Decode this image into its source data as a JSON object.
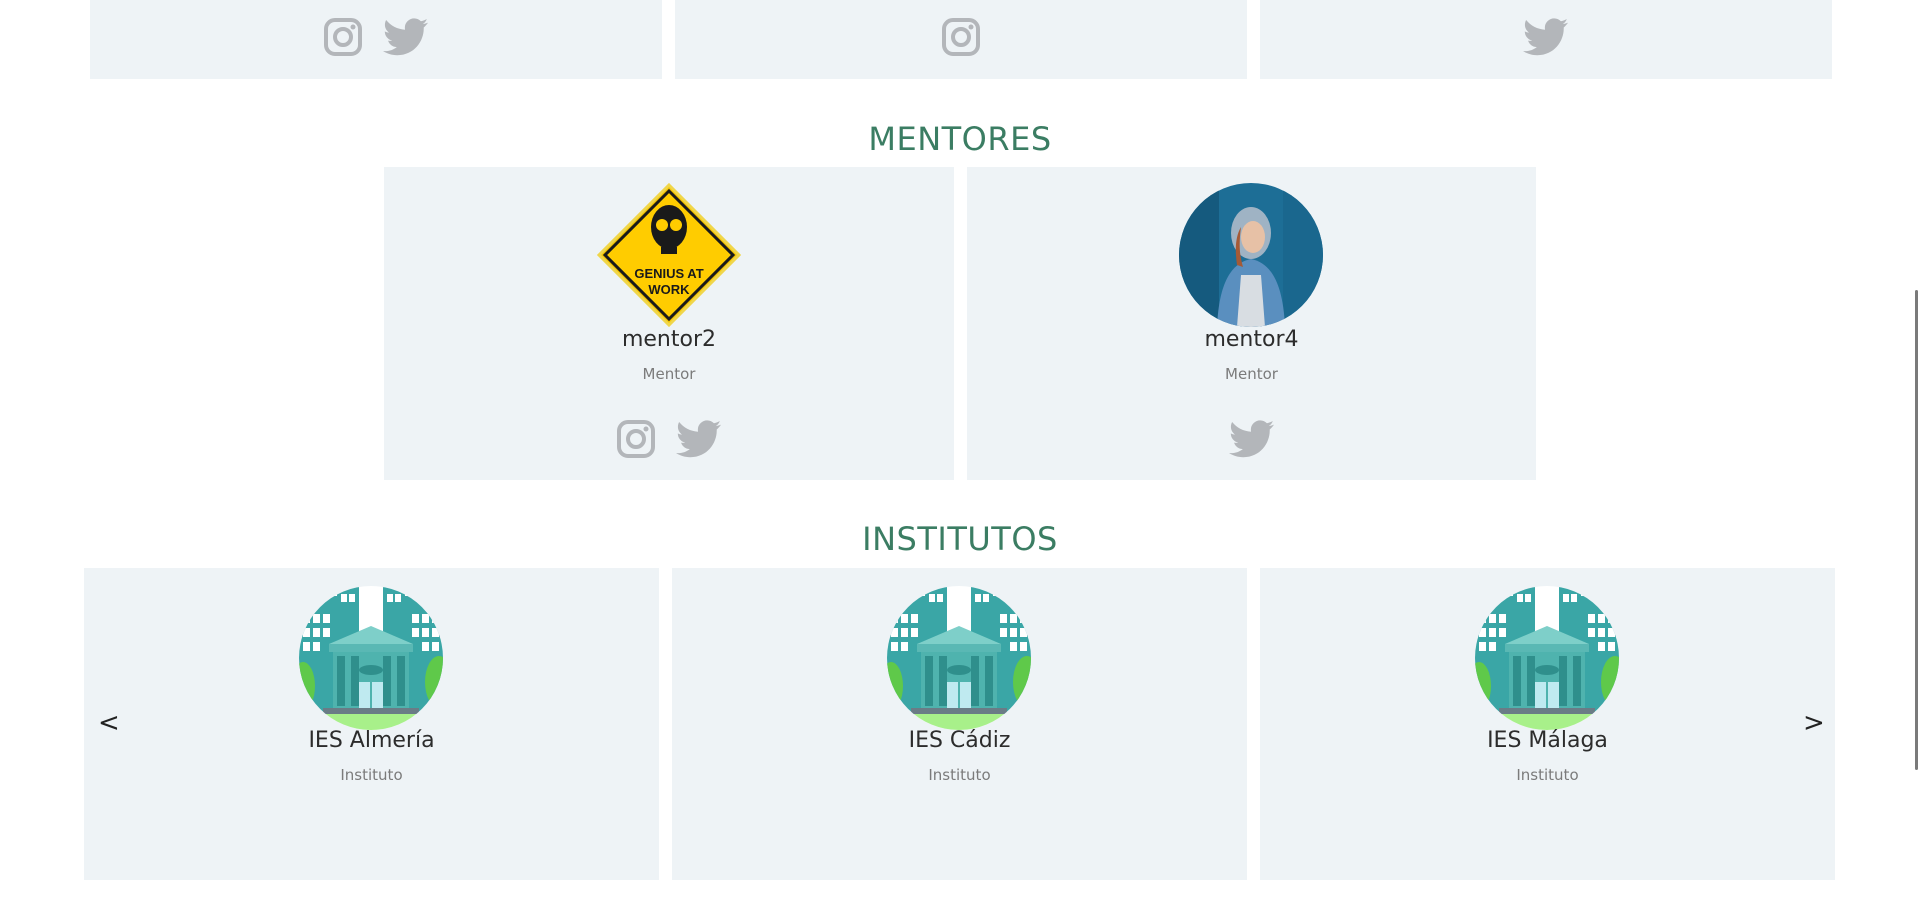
{
  "colors": {
    "accent": "#3b7d63",
    "card": "#eef3f6",
    "icon": "#b3b6ba"
  },
  "top_cards": [
    {
      "icons": [
        "instagram-icon",
        "twitter-icon"
      ]
    },
    {
      "icons": [
        "instagram-icon"
      ]
    },
    {
      "icons": [
        "twitter-icon"
      ]
    }
  ],
  "mentors_section": {
    "title": "MENTORES",
    "items": [
      {
        "name": "mentor2",
        "role": "Mentor",
        "avatar_text": "GENIUS AT WORK",
        "icons": [
          "instagram-icon",
          "twitter-icon"
        ]
      },
      {
        "name": "mentor4",
        "role": "Mentor",
        "icons": [
          "twitter-icon"
        ]
      }
    ]
  },
  "institutes_section": {
    "title": "INSTITUTOS",
    "prev_label": "<",
    "next_label": ">",
    "items": [
      {
        "name": "IES Almería",
        "role": "Instituto"
      },
      {
        "name": "IES Cádiz",
        "role": "Instituto"
      },
      {
        "name": "IES Málaga",
        "role": "Instituto"
      }
    ]
  }
}
